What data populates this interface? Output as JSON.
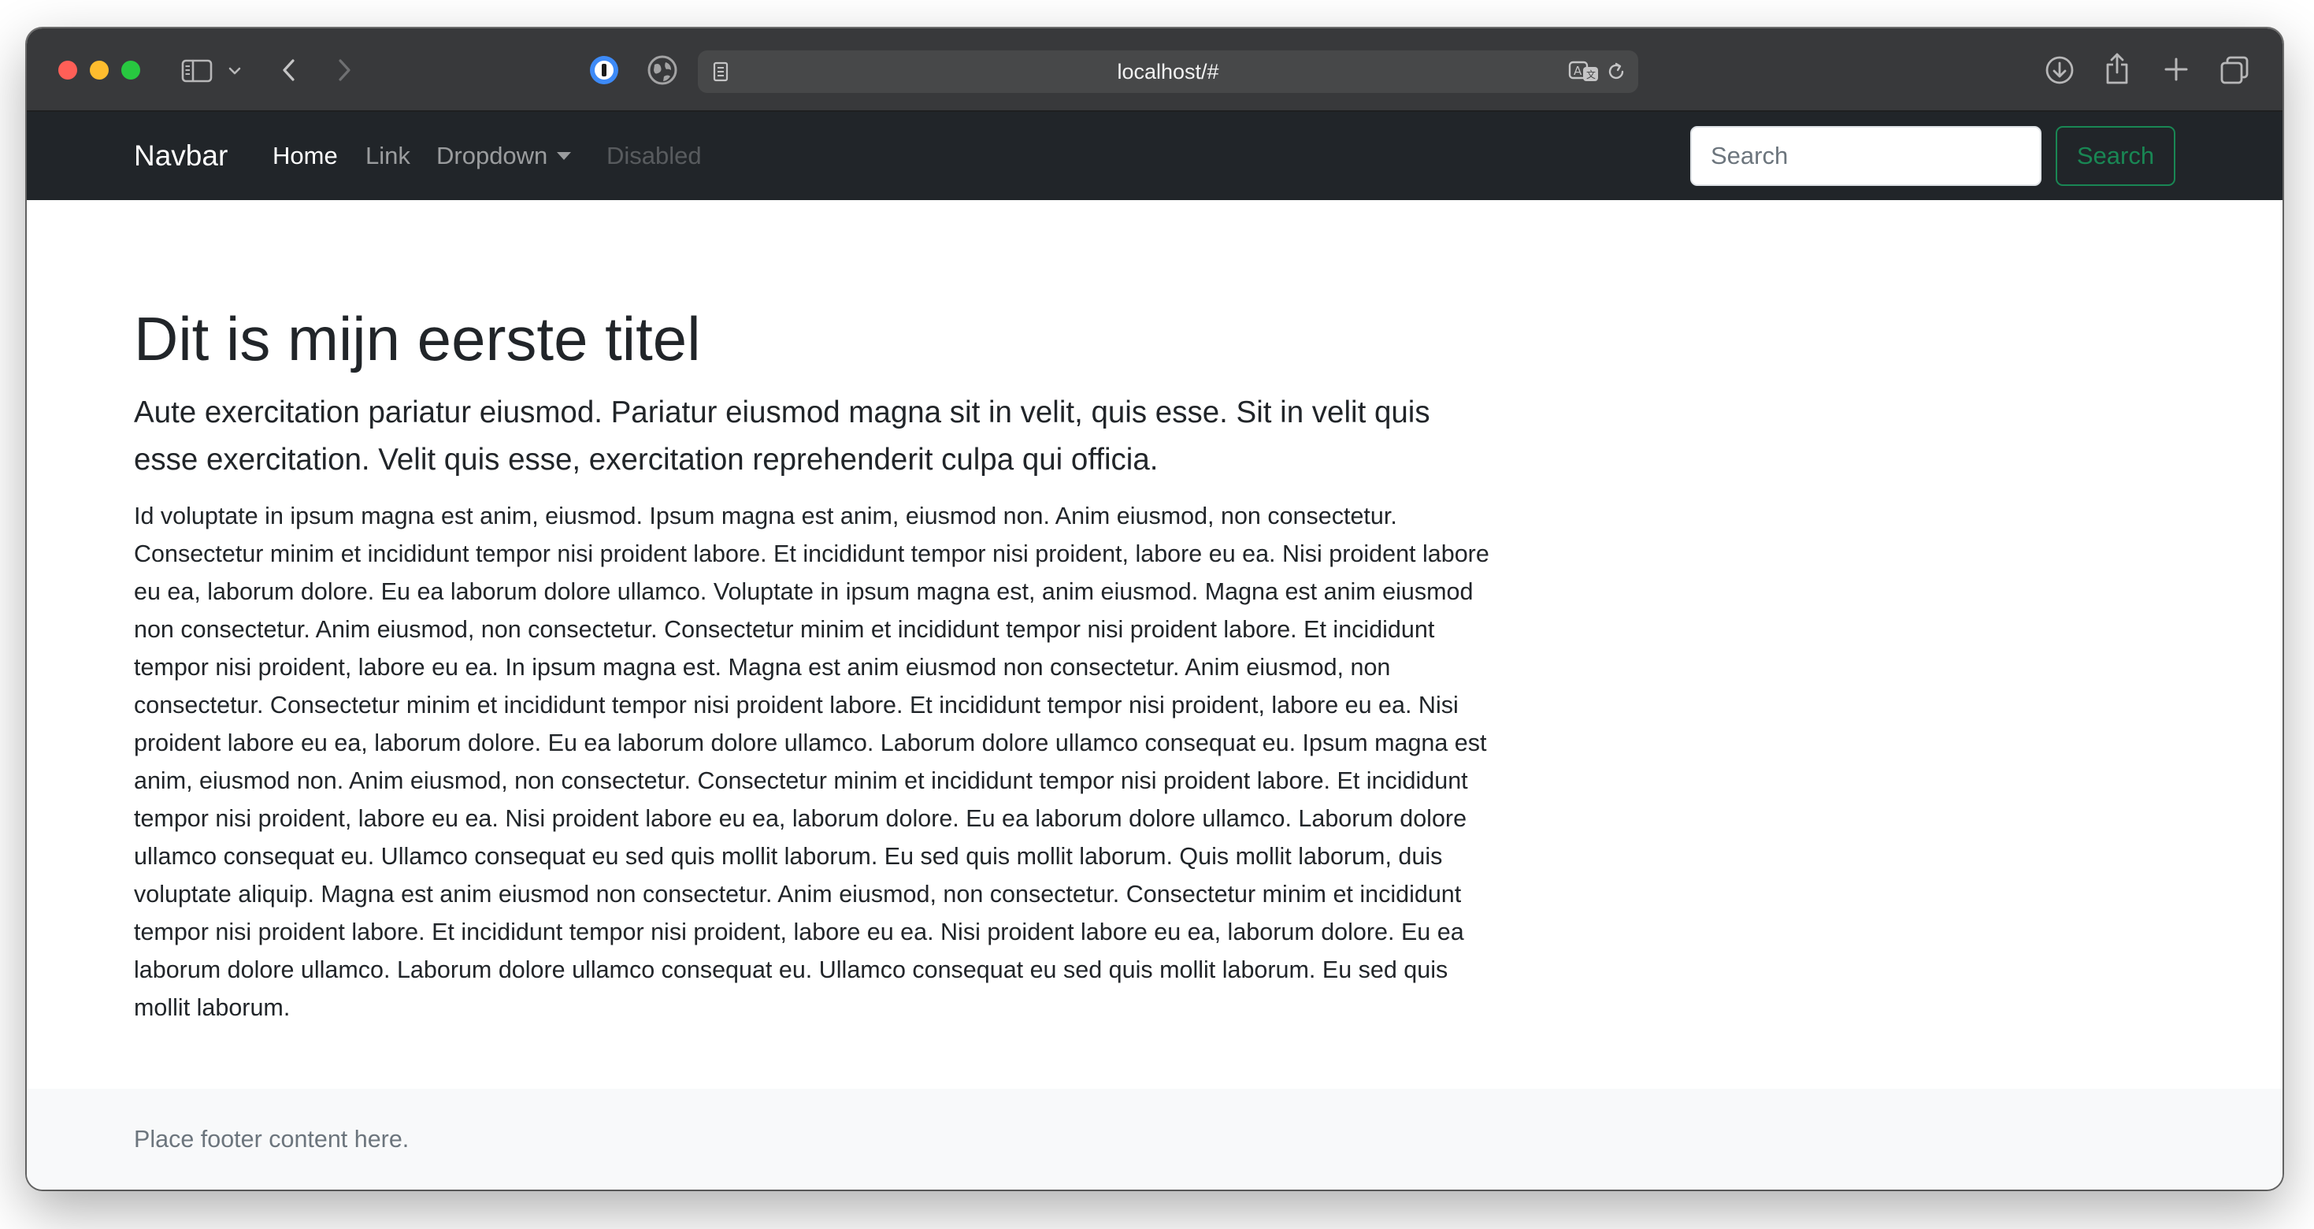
{
  "browser": {
    "url": "localhost/#",
    "icons": {
      "sidebar": "sidebar-toggle-icon",
      "sidebar_menu": "chevron-down-icon",
      "back": "back-arrow-icon",
      "forward": "forward-arrow-icon",
      "password_manager": "password-manager-icon",
      "extension": "globe-icon",
      "reader": "reader-mode-icon",
      "translate": "translate-icon",
      "reload": "reload-icon",
      "downloads": "download-icon",
      "share": "share-icon",
      "new_tab": "plus-icon",
      "tab_overview": "tab-overview-icon"
    }
  },
  "navbar": {
    "brand": "Navbar",
    "links": {
      "home": "Home",
      "link": "Link",
      "dropdown": "Dropdown",
      "disabled": "Disabled"
    },
    "search_placeholder": "Search",
    "search_button": "Search"
  },
  "main": {
    "title": "Dit is mijn eerste titel",
    "lead": "Aute exercitation pariatur eiusmod. Pariatur eiusmod magna sit in velit, quis esse. Sit in velit quis esse exercitation. Velit quis esse, exercitation reprehenderit culpa qui officia.",
    "body": "Id voluptate in ipsum magna est anim, eiusmod. Ipsum magna est anim, eiusmod non. Anim eiusmod, non consectetur. Consectetur minim et incididunt tempor nisi proident labore. Et incididunt tempor nisi proident, labore eu ea. Nisi proident labore eu ea, laborum dolore. Eu ea laborum dolore ullamco. Voluptate in ipsum magna est, anim eiusmod. Magna est anim eiusmod non consectetur. Anim eiusmod, non consectetur. Consectetur minim et incididunt tempor nisi proident labore. Et incididunt tempor nisi proident, labore eu ea. In ipsum magna est. Magna est anim eiusmod non consectetur. Anim eiusmod, non consectetur. Consectetur minim et incididunt tempor nisi proident labore. Et incididunt tempor nisi proident, labore eu ea. Nisi proident labore eu ea, laborum dolore. Eu ea laborum dolore ullamco. Laborum dolore ullamco consequat eu. Ipsum magna est anim, eiusmod non. Anim eiusmod, non consectetur. Consectetur minim et incididunt tempor nisi proident labore. Et incididunt tempor nisi proident, labore eu ea. Nisi proident labore eu ea, laborum dolore. Eu ea laborum dolore ullamco. Laborum dolore ullamco consequat eu. Ullamco consequat eu sed quis mollit laborum. Eu sed quis mollit laborum. Quis mollit laborum, duis voluptate aliquip. Magna est anim eiusmod non consectetur. Anim eiusmod, non consectetur. Consectetur minim et incididunt tempor nisi proident labore. Et incididunt tempor nisi proident, labore eu ea. Nisi proident labore eu ea, laborum dolore. Eu ea laborum dolore ullamco. Laborum dolore ullamco consequat eu. Ullamco consequat eu sed quis mollit laborum. Eu sed quis mollit laborum."
  },
  "footer": {
    "text": "Place footer content here."
  },
  "colors": {
    "navbar_bg": "#212529",
    "chrome_bg": "#38393b",
    "success": "#198754",
    "footer_bg": "#f8f9fa"
  }
}
